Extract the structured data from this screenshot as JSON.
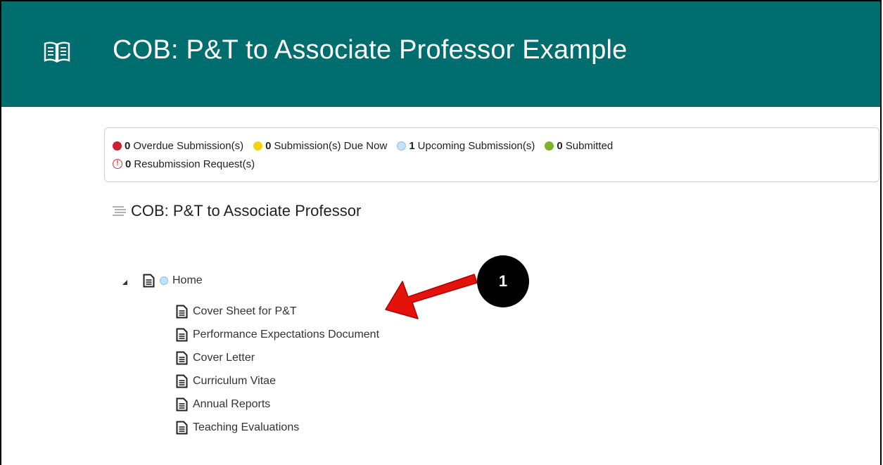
{
  "header": {
    "title": "COB: P&T to Associate Professor Example",
    "background": "#006e6e"
  },
  "status": {
    "overdue": {
      "count": "0",
      "label": "Overdue Submission(s)",
      "color": "#cc1f33"
    },
    "due_now": {
      "count": "0",
      "label": "Submission(s) Due Now",
      "color": "#f2d40b"
    },
    "upcoming": {
      "count": "1",
      "label": "Upcoming Submission(s)",
      "color": "#bfe3f7"
    },
    "submitted": {
      "count": "0",
      "label": "Submitted",
      "color": "#7cb32b"
    },
    "resubmission": {
      "count": "0",
      "label": "Resubmission Request(s)",
      "color": "#d33333"
    }
  },
  "section": {
    "title": "COB: P&T to Associate Professor"
  },
  "tree": {
    "root_label": "Home",
    "children": [
      "Cover Sheet for P&T",
      "Performance Expectations Document",
      "Cover Letter",
      "Curriculum Vitae",
      "Annual Reports",
      "Teaching Evaluations"
    ]
  },
  "annotation": {
    "callout_number": "1",
    "arrow_color": "#e3120b"
  }
}
